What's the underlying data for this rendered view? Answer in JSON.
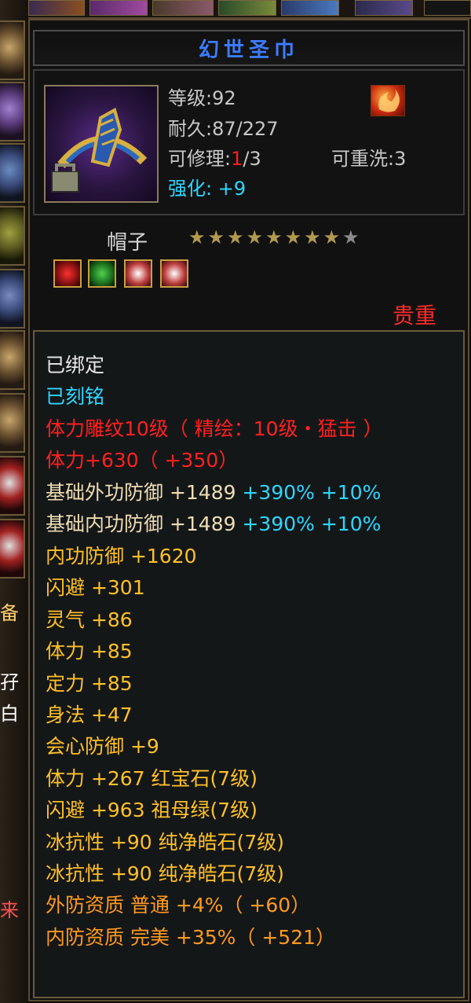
{
  "title": "幻世圣巾",
  "stats": {
    "level": "等级:92",
    "durability": "耐久:87/227",
    "repair_prefix": "可修理:",
    "repair_value": "1",
    "repair_suffix": "/3",
    "rewash": "可重洗:3",
    "strengthen": "强化: +9"
  },
  "item_type": "帽子",
  "star_rating": {
    "filled": 8,
    "total": 9
  },
  "precious_label": "贵重",
  "left_panel": {
    "label1": "备",
    "label2": "孖",
    "label3": "白",
    "label4": "来"
  },
  "attributes": {
    "bound": "已绑定",
    "engraved": "已刻铭",
    "carving": "体力雕纹10级（ 精绘：10级・猛击 ）",
    "stamina_total": "体力+630（ +350）",
    "base_outer_def": {
      "text": "基础外功防御  +1489",
      "bonus": "+390% +10%"
    },
    "base_inner_def": {
      "text": "基础内功防御  +1489",
      "bonus": "+390% +10%"
    },
    "inner_def": "内功防御  +1620",
    "dodge": "闪避  +301",
    "spirit": "灵气  +86",
    "stamina": "体力  +85",
    "focus": "定力  +85",
    "agility": "身法  +47",
    "crit_def": "会心防御  +9",
    "gem1": "体力  +267  红宝石(7级)",
    "gem2": "闪避  +963  祖母绿(7级)",
    "gem3": "冰抗性  +90  纯净皓石(7级)",
    "gem4": "冰抗性  +90  纯净皓石(7级)",
    "outer_aptitude": "外防资质  普通  +4%（ +60）",
    "inner_aptitude": "内防资质  完美  +35%（ +521）"
  },
  "colors": {
    "title": "#3d7cff",
    "precious": "#ff2a2a",
    "cyan": "#2ed6ff",
    "red": "#ff2020",
    "beige": "#eedcb4",
    "gold": "#ffc02a",
    "orange": "#ff9a20",
    "white": "#e8e8e8"
  },
  "icons": {
    "item": "helmet-crescent-icon",
    "badge": "flame-badge-icon",
    "gems": [
      "ruby-gem-icon",
      "emerald-gem-icon",
      "diamond-gem-icon",
      "diamond-gem-icon"
    ]
  }
}
